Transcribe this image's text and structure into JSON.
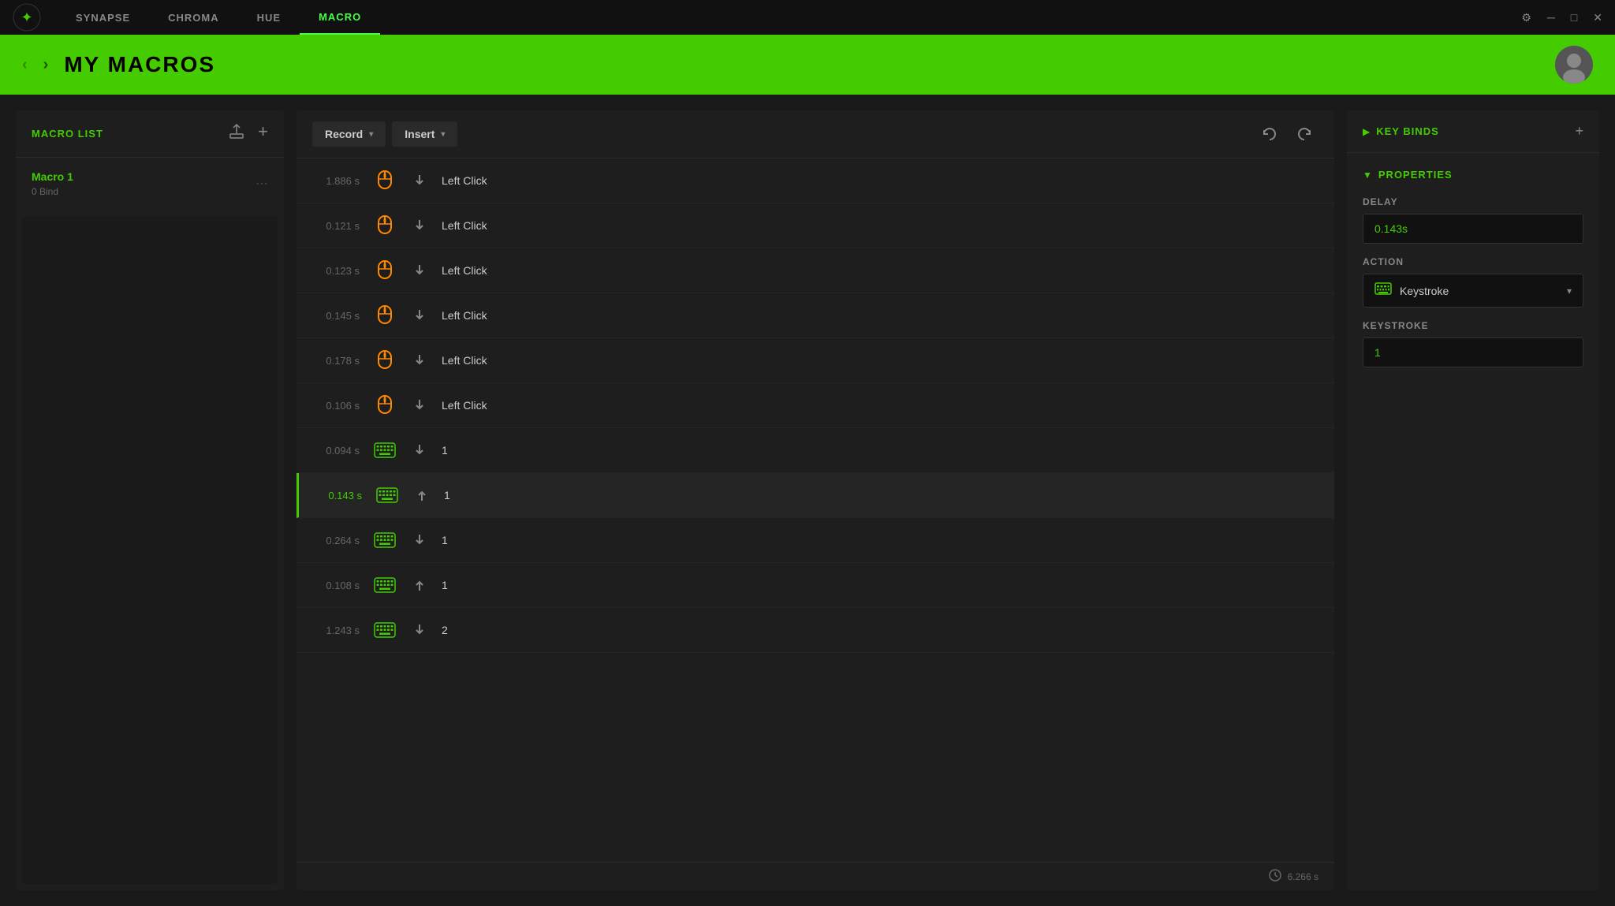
{
  "app": {
    "logo_symbol": "✦",
    "title": "Razer Synapse"
  },
  "titlebar": {
    "nav_items": [
      {
        "id": "synapse",
        "label": "SYNAPSE",
        "active": false
      },
      {
        "id": "chroma",
        "label": "CHROMA",
        "active": false
      },
      {
        "id": "hue",
        "label": "HUE",
        "active": false
      },
      {
        "id": "macro",
        "label": "MACRO",
        "active": true
      }
    ],
    "controls": {
      "settings": "⚙",
      "minimize": "─",
      "maximize": "□",
      "close": "✕"
    }
  },
  "header": {
    "back_label": "‹",
    "forward_label": "›",
    "title": "MY MACROS"
  },
  "macro_list": {
    "title": "MACRO LIST",
    "export_icon": "↑",
    "add_icon": "+",
    "items": [
      {
        "name": "Macro 1",
        "bind": "0 Bind",
        "more_icon": "···"
      }
    ]
  },
  "macro_editor": {
    "record_label": "Record",
    "record_chevron": "▾",
    "insert_label": "Insert",
    "insert_chevron": "▾",
    "undo_icon": "↺",
    "redo_icon": "↻",
    "entries": [
      {
        "time": "1.886 s",
        "type": "mouse",
        "direction": "down",
        "label": "Left Click",
        "highlighted": false,
        "selected": false
      },
      {
        "time": "0.121 s",
        "type": "mouse",
        "direction": "down",
        "label": "Left Click",
        "highlighted": false,
        "selected": false
      },
      {
        "time": "0.123 s",
        "type": "mouse",
        "direction": "down",
        "label": "Left Click",
        "highlighted": false,
        "selected": false
      },
      {
        "time": "0.145 s",
        "type": "mouse",
        "direction": "down",
        "label": "Left Click",
        "highlighted": false,
        "selected": false
      },
      {
        "time": "0.178 s",
        "type": "mouse",
        "direction": "down",
        "label": "Left Click",
        "highlighted": false,
        "selected": false
      },
      {
        "time": "0.106 s",
        "type": "mouse",
        "direction": "down",
        "label": "Left Click",
        "highlighted": false,
        "selected": false
      },
      {
        "time": "0.094 s",
        "type": "keyboard",
        "direction": "down",
        "label": "1",
        "highlighted": false,
        "selected": false
      },
      {
        "time": "0.143 s",
        "type": "keyboard",
        "direction": "up",
        "label": "1",
        "highlighted": true,
        "selected": true
      },
      {
        "time": "0.264 s",
        "type": "keyboard",
        "direction": "down",
        "label": "1",
        "highlighted": false,
        "selected": false
      },
      {
        "time": "0.108 s",
        "type": "keyboard",
        "direction": "up",
        "label": "1",
        "highlighted": false,
        "selected": false
      },
      {
        "time": "1.243 s",
        "type": "keyboard",
        "direction": "down",
        "label": "2",
        "highlighted": false,
        "selected": false
      }
    ],
    "footer": {
      "clock_icon": "🕐",
      "total_time": "6.266 s"
    }
  },
  "properties": {
    "keybinds_title": "KEY BINDS",
    "keybinds_add": "+",
    "properties_title": "PROPERTIES",
    "delay_label": "DELAY",
    "delay_value": "0.143s",
    "action_label": "ACTION",
    "action_value": "Keystroke",
    "keystroke_label": "KEYSTROKE",
    "keystroke_value": "1"
  },
  "colors": {
    "green": "#44cc00",
    "orange": "#ff8800",
    "dark_bg": "#1a1a1a",
    "panel_bg": "#1e1e1e",
    "input_bg": "#111111",
    "border": "#2a2a2a"
  }
}
